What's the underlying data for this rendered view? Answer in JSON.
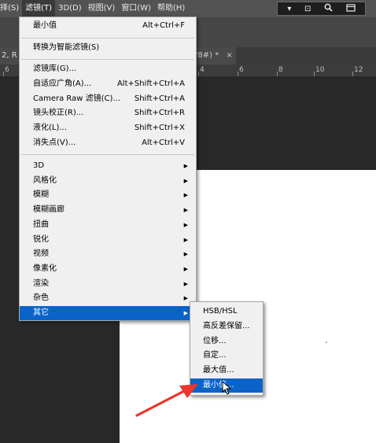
{
  "menubar": {
    "items": [
      "择(S)",
      "滤镜(T)",
      "3D(D)",
      "视图(V)",
      "窗口(W)",
      "帮助(H)"
    ],
    "active_index": 1,
    "window_controls": [
      "▾",
      "⊡",
      "🔍",
      "⬚"
    ]
  },
  "tabs": {
    "left_tab": "2, R",
    "right_tab": "/8#) *"
  },
  "ruler": {
    "labels": [
      "6",
      "4",
      "6",
      "8",
      "10",
      "12"
    ]
  },
  "filter_menu": {
    "items": [
      {
        "label": "最小值",
        "shortcut": "Alt+Ctrl+F"
      },
      {
        "label": "转换为智能滤镜(S)",
        "shortcut": ""
      },
      {
        "label": "滤镜库(G)...",
        "shortcut": ""
      },
      {
        "label": "自适应广角(A)...",
        "shortcut": "Alt+Shift+Ctrl+A"
      },
      {
        "label": "Camera Raw 滤镜(C)...",
        "shortcut": "Shift+Ctrl+A"
      },
      {
        "label": "镜头校正(R)...",
        "shortcut": "Shift+Ctrl+R"
      },
      {
        "label": "液化(L)...",
        "shortcut": "Shift+Ctrl+X"
      },
      {
        "label": "消失点(V)...",
        "shortcut": "Alt+Ctrl+V"
      },
      {
        "label": "3D",
        "shortcut": ""
      },
      {
        "label": "风格化",
        "shortcut": ""
      },
      {
        "label": "模糊",
        "shortcut": ""
      },
      {
        "label": "模糊画廊",
        "shortcut": ""
      },
      {
        "label": "扭曲",
        "shortcut": ""
      },
      {
        "label": "锐化",
        "shortcut": ""
      },
      {
        "label": "视频",
        "shortcut": ""
      },
      {
        "label": "像素化",
        "shortcut": ""
      },
      {
        "label": "渲染",
        "shortcut": ""
      },
      {
        "label": "杂色",
        "shortcut": ""
      },
      {
        "label": "其它",
        "shortcut": ""
      }
    ],
    "submenu_arrow": "▶"
  },
  "submenu": {
    "items": [
      "HSB/HSL",
      "高反差保留...",
      "位移...",
      "自定...",
      "最大值...",
      "最小值..."
    ],
    "highlighted_index": 5
  },
  "colors": {
    "highlight": "#0a64c8",
    "annotation_arrow": "#e8372c"
  }
}
